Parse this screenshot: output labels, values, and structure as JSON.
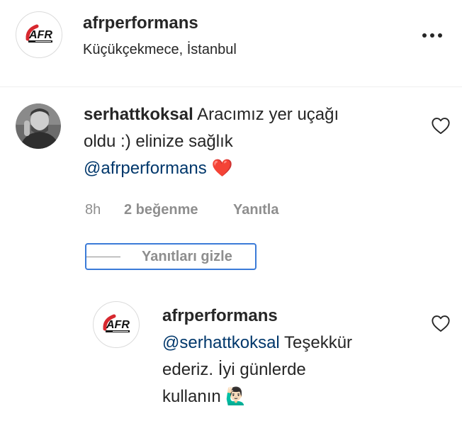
{
  "post_header": {
    "username": "afrperformans",
    "location": "Küçükçekmece, İstanbul",
    "more_icon": "more-horizontal-icon"
  },
  "comment": {
    "username": "serhattkoksal",
    "text_line1": " Aracımız yer uçağı",
    "text_line2": "oldu :) elinize sağlık",
    "mention": "@afrperformans",
    "emoji": "❤️",
    "time": "8h",
    "likes": "2 beğenme",
    "reply_label": "Yanıtla",
    "hide_replies_label": "Yanıtları gizle",
    "like_icon": "heart-icon"
  },
  "reply": {
    "username": "afrperformans",
    "mention": "@serhattkoksal",
    "text_line1_rest": " Teşekkür",
    "text_line2": "ederiz. İyi günlerde",
    "text_line3": "kullanın ",
    "emoji": "🙋🏻‍♂️",
    "like_icon": "heart-icon"
  },
  "colors": {
    "text": "#262626",
    "secondary": "#8e8e8e",
    "mention": "#00376b",
    "logo_red": "#d7282f",
    "focus": "#3b7bd8"
  }
}
